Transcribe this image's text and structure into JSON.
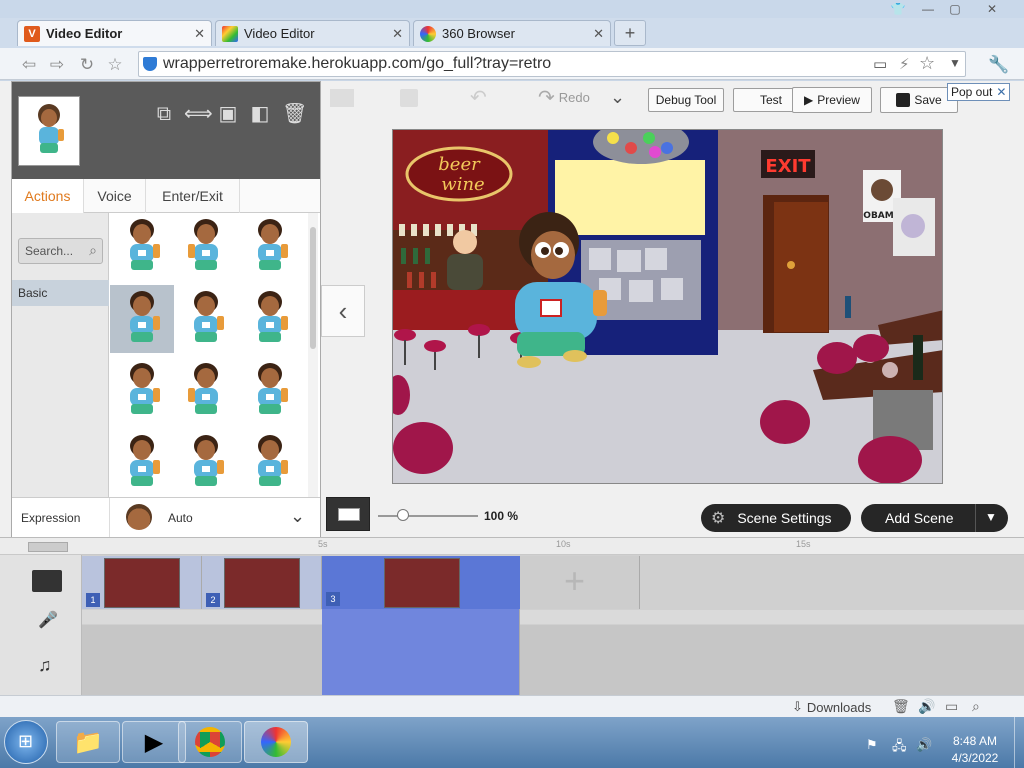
{
  "browser": {
    "tabs": [
      {
        "label": "Video Editor",
        "active": true
      },
      {
        "label": "Video Editor",
        "active": false
      },
      {
        "label": "360 Browser",
        "active": false
      }
    ],
    "url": "wrapperretroremake.herokuapp.com/go_full?tray=retro",
    "new_tab": "+"
  },
  "editor_toolbar": {
    "redo_label": "Redo",
    "debug_label": "Debug Tool",
    "test_label": "Test",
    "preview_label": "Preview",
    "save_label": "Save",
    "popout_label": "Pop out"
  },
  "char_panel": {
    "tabs": [
      "Actions",
      "Voice",
      "Enter/Exit"
    ],
    "search_placeholder": "Search...",
    "category": "Basic",
    "expression_label": "Expression",
    "expression_value": "Auto"
  },
  "stage": {
    "sign_text": "beer wine",
    "exit_text": "EXIT",
    "poster_text": "OBAMA"
  },
  "scene_controls": {
    "zoom_value": "100 %",
    "zoom_fraction": 0.25,
    "scene_settings_label": "Scene Settings",
    "add_scene_label": "Add Scene"
  },
  "timeline": {
    "ruler_marks": [
      "5s",
      "10s",
      "15s"
    ],
    "scenes": [
      "1",
      "2",
      "3"
    ]
  },
  "status": {
    "downloads_label": "Downloads"
  },
  "taskbar": {
    "time": "8:48 AM",
    "date": "4/3/2022"
  },
  "colors": {
    "accent": "#e07a1e",
    "selected_scene": "#5b77d6"
  }
}
